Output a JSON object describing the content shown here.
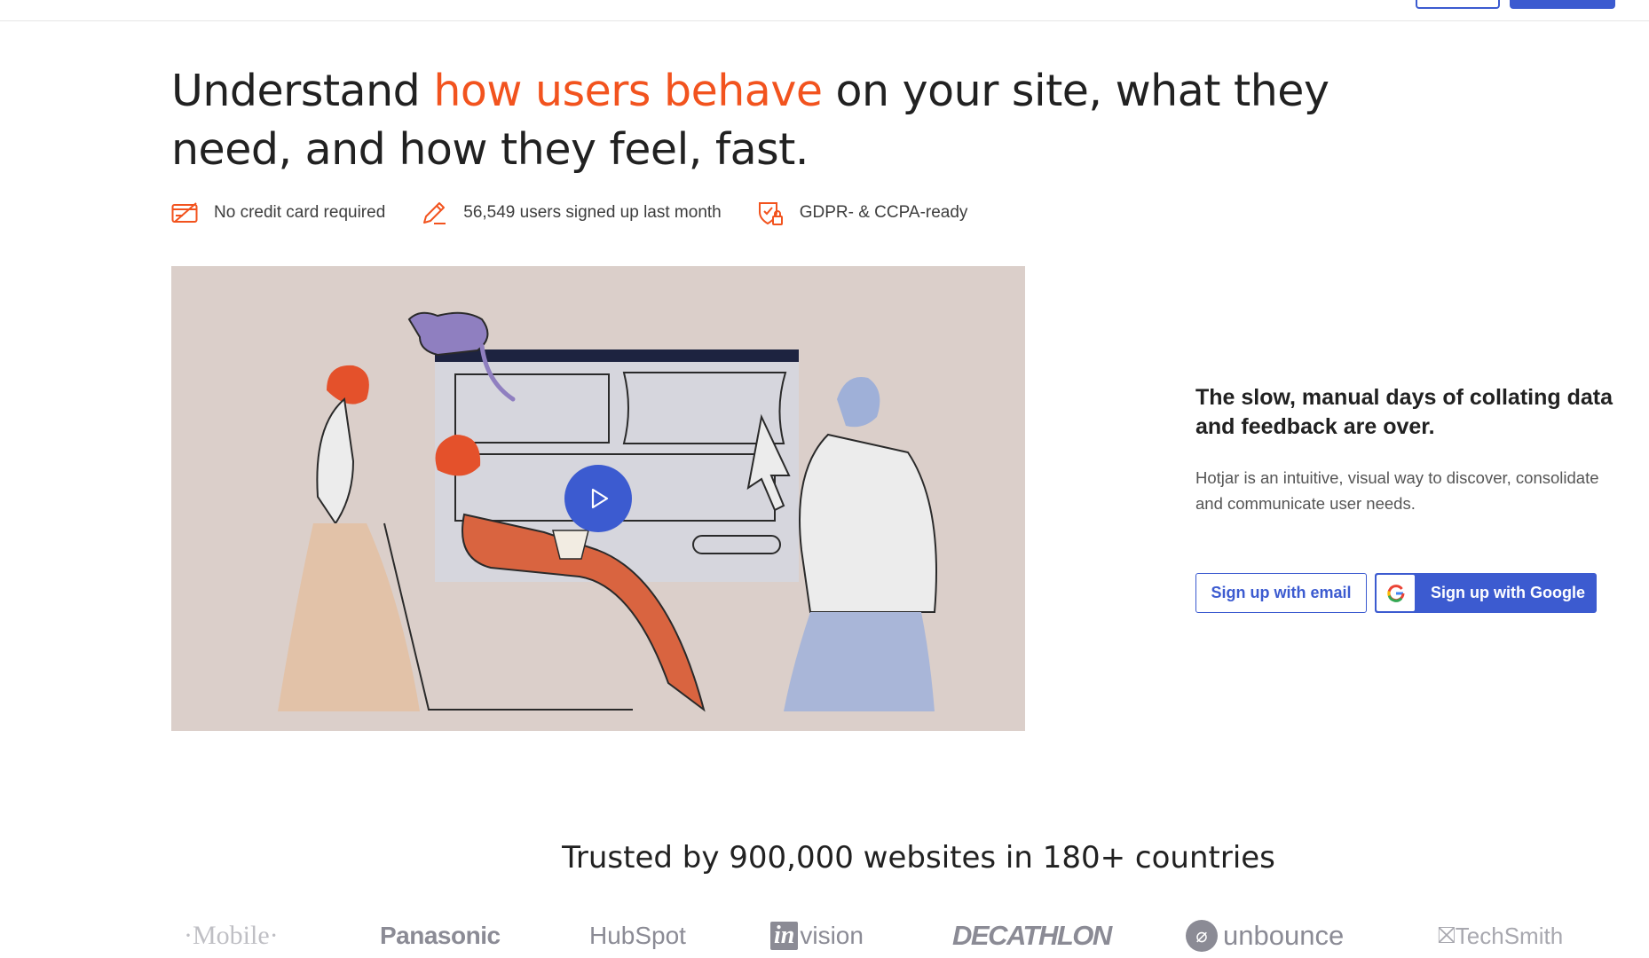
{
  "hero": {
    "headline_before": "Understand ",
    "headline_accent": "how users behave",
    "headline_after": " on your site, what they need, and how they feel, fast."
  },
  "features": [
    {
      "icon": "credit-card-icon",
      "label": "No credit card required"
    },
    {
      "icon": "pencil-icon",
      "label": "56,549 users signed up last month"
    },
    {
      "icon": "shield-lock-icon",
      "label": "GDPR- & CCPA-ready"
    }
  ],
  "video": {
    "play_icon": "play-icon"
  },
  "side": {
    "title_line1": "The slow, manual days of collating data",
    "title_line2": "and feedback are over.",
    "desc_line1": "Hotjar is an intuitive, visual way to discover, consolidate",
    "desc_line2": "and communicate user needs.",
    "email_button": "Sign up with email",
    "google_button": "Sign up with Google"
  },
  "trusted": {
    "title": "Trusted by 900,000 websites in 180+ countries"
  },
  "logos": [
    "·Mobile·",
    "Panasonic",
    "HubSpot",
    "in",
    "vision",
    "DECATHLON",
    "unbounce",
    "TechSmith"
  ],
  "colors": {
    "accent": "#f2531e",
    "primary": "#3c5bd0",
    "video_bg": "#dbcfca"
  }
}
